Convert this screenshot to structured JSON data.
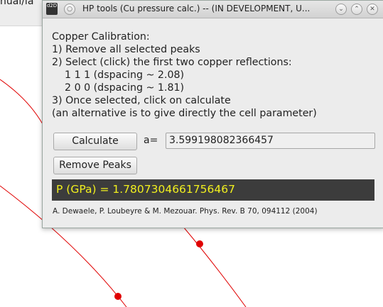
{
  "background": {
    "path_fragment": "nual/la",
    "line_color": "#e00000"
  },
  "dialog": {
    "title": "HP tools (Cu pressure calc.) -- (IN DEVELOPMENT, U...",
    "app_icon_text": "d2D",
    "title_buttons": [
      "chevron-down",
      "chevron-up",
      "close"
    ],
    "instructions": [
      "Copper Calibration:",
      "1) Remove all selected peaks",
      "2) Select (click) the first two copper reflections:",
      "    1 1 1 (dspacing ~ 2.08)",
      "    2 0 0 (dspacing ~ 1.81)",
      "3) Once selected, click on calculate",
      "(an alternative is to give directly the cell parameter)"
    ],
    "calculate_label": "Calculate",
    "a_label": "a=",
    "a_value": "3.599198082366457",
    "remove_label": "Remove Peaks",
    "result_text": "P (GPa) = 1.7807304661756467",
    "result_color": "#f1ef1e",
    "reference": "A. Dewaele, P. Loubeyre & M. Mezouar. Phys. Rev. B 70, 094112 (2004)"
  }
}
